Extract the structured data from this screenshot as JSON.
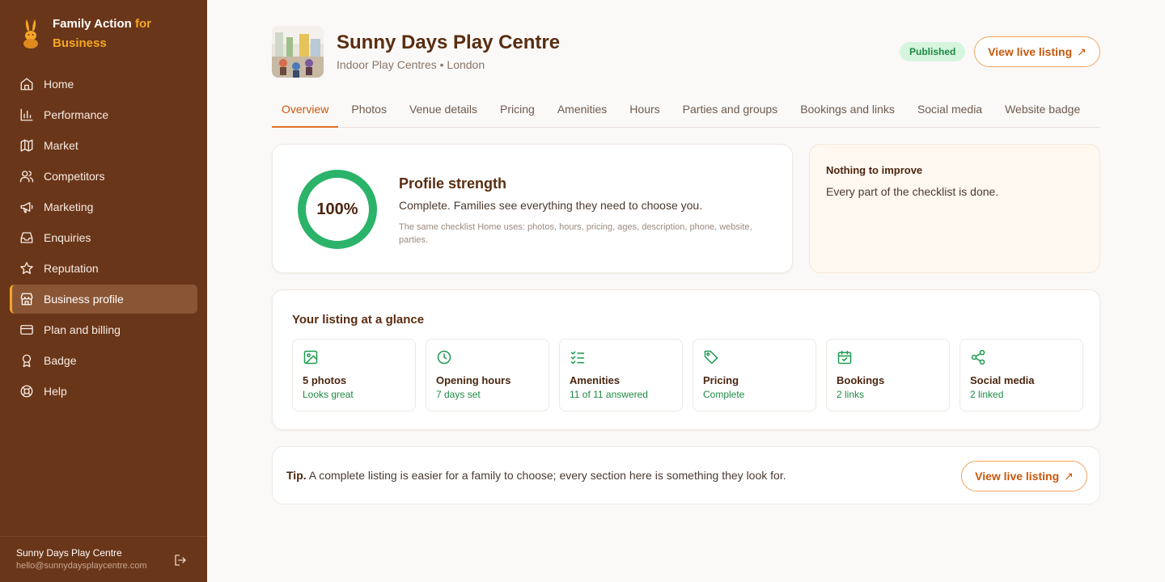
{
  "brand": {
    "name_main": "Family Action",
    "name_accent": "for",
    "name_tail": "Business",
    "logo_icon": "rabbit-logo"
  },
  "sidebar": {
    "items": [
      {
        "label": "Home",
        "icon": "home-icon"
      },
      {
        "label": "Performance",
        "icon": "bar-chart-icon"
      },
      {
        "label": "Market",
        "icon": "map-icon"
      },
      {
        "label": "Competitors",
        "icon": "users-icon"
      },
      {
        "label": "Marketing",
        "icon": "megaphone-icon"
      },
      {
        "label": "Enquiries",
        "icon": "inbox-icon"
      },
      {
        "label": "Reputation",
        "icon": "star-icon"
      },
      {
        "label": "Business profile",
        "icon": "store-icon",
        "active": true
      },
      {
        "label": "Plan and billing",
        "icon": "credit-card-icon"
      },
      {
        "label": "Badge",
        "icon": "award-icon"
      },
      {
        "label": "Help",
        "icon": "lifebuoy-icon"
      }
    ],
    "footer": {
      "name": "Sunny Days Play Centre",
      "email": "hello@sunnydaysplaycentre.com"
    }
  },
  "header": {
    "title": "Sunny Days Play Centre",
    "subtitle": "Indoor Play Centres • London",
    "status": "Published",
    "view_listing": "View live listing",
    "arrow": "↗"
  },
  "tabs": [
    "Overview",
    "Photos",
    "Venue details",
    "Pricing",
    "Amenities",
    "Hours",
    "Parties and groups",
    "Bookings and links",
    "Social media",
    "Website badge"
  ],
  "active_tab": "Overview",
  "strength": {
    "percent_label": "100%",
    "percent": 100,
    "title": "Profile strength",
    "description": "Complete. Families see everything they need to choose you.",
    "note": "The same checklist Home uses: photos, hours, pricing, ages, description, phone, website, parties."
  },
  "improve": {
    "title": "Nothing to improve",
    "text": "Every part of the checklist is done."
  },
  "glance": {
    "title": "Your listing at a glance",
    "items": [
      {
        "label": "5 photos",
        "status": "Looks great",
        "icon": "image-icon"
      },
      {
        "label": "Opening hours",
        "status": "7 days set",
        "icon": "clock-icon"
      },
      {
        "label": "Amenities",
        "status": "11 of 11 answered",
        "icon": "checklist-icon"
      },
      {
        "label": "Pricing",
        "status": "Complete",
        "icon": "tag-icon"
      },
      {
        "label": "Bookings",
        "status": "2 links",
        "icon": "calendar-icon"
      },
      {
        "label": "Social media",
        "status": "2 linked",
        "icon": "share-icon"
      }
    ]
  },
  "tip": {
    "lead": "Tip.",
    "text": " A complete listing is easier for a family to choose; every section here is something they look for.",
    "button": "View live listing",
    "arrow": "↗"
  },
  "colors": {
    "sidebar": "#6a3619",
    "accent": "#f5a623",
    "primary": "#e2702a",
    "success": "#2bb36a"
  }
}
